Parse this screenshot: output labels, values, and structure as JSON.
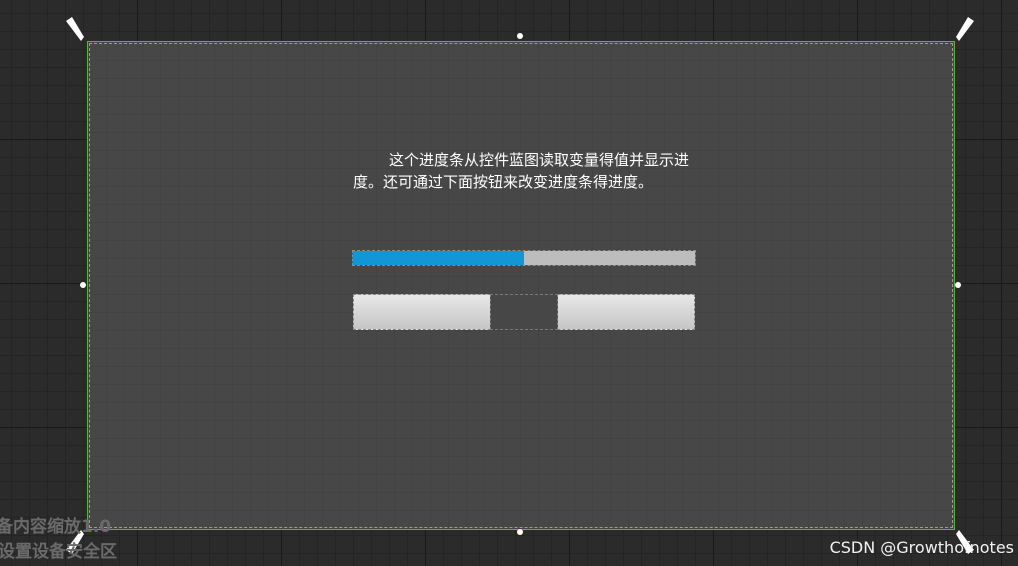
{
  "widget": {
    "description": "这个进度条从控件蓝图读取变量得值并显示进度。还可通过下面按钮来改变进度条得进度。"
  },
  "progress_bar": {
    "percent": 0.5,
    "fill_color": "#1196d6",
    "background_color": "#bdbdbd"
  },
  "canvas": {
    "border_color": "#39d000",
    "background_color": "#474747"
  },
  "overlay": {
    "scale_line": "备内容缩放1.0",
    "safe_zone_line": "设置设备安全区"
  },
  "watermark": {
    "text": "CSDN @Growthofnotes"
  }
}
